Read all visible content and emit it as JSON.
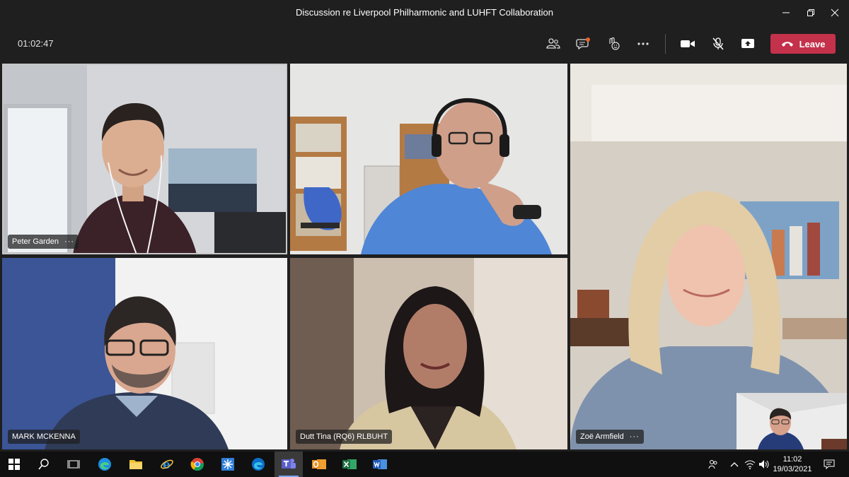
{
  "window": {
    "title": "Discussion re Liverpool Philharmonic and LUHFT Collaboration",
    "controls": [
      "minimize-icon",
      "maximize-icon",
      "close-icon"
    ]
  },
  "meeting": {
    "elapsed": "01:02:47",
    "leave_label": "Leave",
    "toolbar_icons": [
      "people-icon",
      "chat-icon",
      "reactions-icon",
      "more-icon",
      "camera-icon",
      "mic-muted-icon",
      "share-screen-icon",
      "hang-up-icon"
    ]
  },
  "participants": [
    {
      "name": "Peter Garden",
      "show_more": true
    },
    {
      "name": "",
      "show_more": false
    },
    {
      "name": "Zoë Armfield",
      "show_more": true
    },
    {
      "name": "MARK MCKENNA",
      "show_more": false
    },
    {
      "name": "Dutt Tina (RQ6) RLBUHT",
      "show_more": false
    }
  ],
  "more_glyph": "···",
  "taskbar": {
    "apps": [
      "windows-start-icon",
      "search-icon",
      "task-view-icon",
      "edge-icon",
      "file-explorer-icon",
      "internet-explorer-icon",
      "chrome-icon",
      "snowflake-app-icon",
      "edge-beta-icon",
      "teams-icon",
      "outlook-icon",
      "excel-icon",
      "word-icon"
    ],
    "tray_icons": [
      "people-icon",
      "chevron-up-icon",
      "network-icon",
      "volume-icon",
      "notification-icon"
    ],
    "time": "11:02",
    "date": "19/03/2021"
  },
  "colors": {
    "leave_button": "#c4314b",
    "teams_purple": "#5b5fc7",
    "chat_badge": "#e8612c"
  }
}
